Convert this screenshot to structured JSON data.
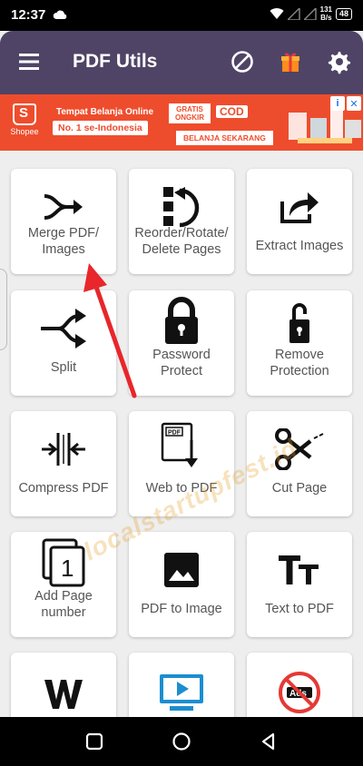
{
  "status_bar": {
    "time": "12:37",
    "net_speed_value": "131",
    "net_speed_unit": "B/s",
    "battery": "48"
  },
  "app_bar": {
    "title": "PDF Utils"
  },
  "ad": {
    "brand": "Shopee",
    "headline": "Tempat Belanja Online",
    "subline": "No. 1 se-Indonesia",
    "gratis_ongkir": "GRATIS ONGKIR",
    "cod": "COD",
    "cta": "BELANJA SEKARANG"
  },
  "tools": [
    {
      "label": "Merge PDF/\nImages",
      "icon": "merge-arrows-icon"
    },
    {
      "label": "Reorder/Rotate/\nDelete Pages",
      "icon": "reorder-rotate-icon"
    },
    {
      "label": "Extract Images",
      "icon": "share-export-icon"
    },
    {
      "label": "Split",
      "icon": "split-arrows-icon"
    },
    {
      "label": "Password\nProtect",
      "icon": "lock-icon"
    },
    {
      "label": "Remove\nProtection",
      "icon": "unlock-icon"
    },
    {
      "label": "Compress PDF",
      "icon": "compress-icon"
    },
    {
      "label": "Web to PDF",
      "icon": "pdf-download-icon"
    },
    {
      "label": "Cut Page",
      "icon": "scissors-icon"
    },
    {
      "label": "Add Page\nnumber",
      "icon": "page-number-icon"
    },
    {
      "label": "PDF to Image",
      "icon": "image-icon"
    },
    {
      "label": "Text to PDF",
      "icon": "text-size-icon"
    },
    {
      "label": "",
      "icon": "word-w-icon"
    },
    {
      "label": "",
      "icon": "slideshow-icon"
    },
    {
      "label": "",
      "icon": "no-ads-icon"
    }
  ],
  "overlay": {
    "watermark": "localstartupfest.id"
  },
  "colors": {
    "app_bar": "#4f4466",
    "ad_background": "#ee4d2d",
    "annotation_arrow": "#e8262b",
    "gift": "#ff9a1f"
  }
}
